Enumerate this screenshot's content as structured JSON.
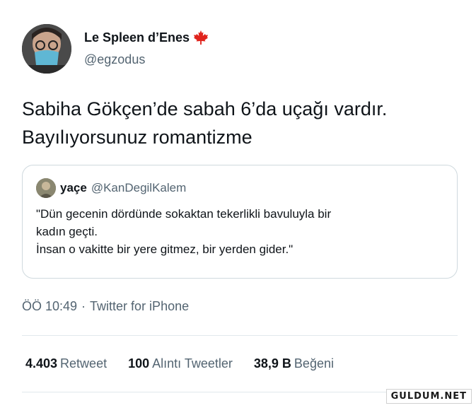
{
  "tweet": {
    "author": {
      "display_name": "Le Spleen d’Enes",
      "handle": "@egzodus",
      "flag_icon": "canada-maple-leaf-icon"
    },
    "text": "Sabiha Gökçen’de sabah 6’da uçağı vardır. Bayılıyorsunuz romantizme",
    "quote": {
      "display_name": "yaçe",
      "handle": "@KanDegilKalem",
      "lines": [
        "\"Dün gecenin dördünde sokaktan tekerlikli bavuluyla bir",
        "kadın geçti.",
        "İnsan o vakitte bir yere gitmez, bir yerden gider.\""
      ]
    },
    "meta": {
      "time": "ÖÖ 10:49",
      "separator": "·",
      "source": "Twitter for iPhone"
    },
    "stats": [
      {
        "count": "4.403",
        "label": "Retweet"
      },
      {
        "count": "100",
        "label": "Alıntı Tweetler"
      },
      {
        "count": "38,9 B",
        "label": "Beğeni"
      }
    ]
  },
  "watermark": "GULDUM.NET",
  "colors": {
    "text": "#0f1419",
    "secondary": "#536471",
    "border": "#cfd9de",
    "flag": "#e0231c"
  }
}
